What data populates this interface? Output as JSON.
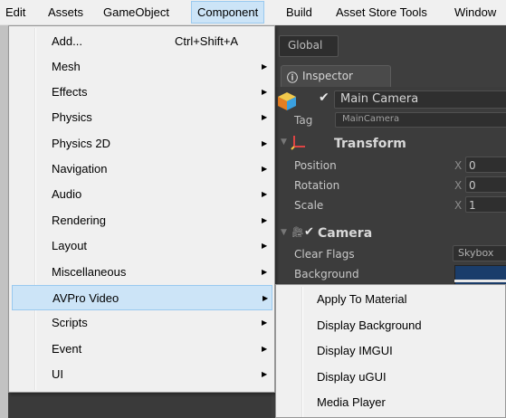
{
  "menubar": {
    "items": [
      {
        "label": "Edit"
      },
      {
        "label": "Assets"
      },
      {
        "label": "GameObject"
      },
      {
        "label": "Component"
      },
      {
        "label": "Build"
      },
      {
        "label": "Asset Store Tools"
      },
      {
        "label": "Window"
      }
    ],
    "active_index": 3
  },
  "component_menu": {
    "items": [
      {
        "label": "Add...",
        "shortcut": "Ctrl+Shift+A",
        "arrow": ""
      },
      {
        "label": "Mesh",
        "shortcut": "",
        "arrow": "▶"
      },
      {
        "label": "Effects",
        "shortcut": "",
        "arrow": "▶"
      },
      {
        "label": "Physics",
        "shortcut": "",
        "arrow": "▶"
      },
      {
        "label": "Physics 2D",
        "shortcut": "",
        "arrow": "▶"
      },
      {
        "label": "Navigation",
        "shortcut": "",
        "arrow": "▶"
      },
      {
        "label": "Audio",
        "shortcut": "",
        "arrow": "▶"
      },
      {
        "label": "Rendering",
        "shortcut": "",
        "arrow": "▶"
      },
      {
        "label": "Layout",
        "shortcut": "",
        "arrow": "▶"
      },
      {
        "label": "Miscellaneous",
        "shortcut": "",
        "arrow": "▶"
      },
      {
        "label": "AVPro Video",
        "shortcut": "",
        "arrow": "▶"
      },
      {
        "label": "Scripts",
        "shortcut": "",
        "arrow": "▶"
      },
      {
        "label": "Event",
        "shortcut": "",
        "arrow": "▶"
      },
      {
        "label": "UI",
        "shortcut": "",
        "arrow": "▶"
      }
    ],
    "highlighted_index": 10
  },
  "avpro_submenu": {
    "items": [
      {
        "label": "Apply To Material"
      },
      {
        "label": "Display Background"
      },
      {
        "label": "Display IMGUI"
      },
      {
        "label": "Display uGUI"
      },
      {
        "label": "Media Player"
      }
    ]
  },
  "editor": {
    "global_label": "Global",
    "inspector_tab": "Inspector",
    "object_name": "Main Camera",
    "tag_label": "Tag",
    "tag_value": "MainCamera",
    "transform": {
      "title": "Transform",
      "rows": [
        {
          "label": "Position",
          "axis": "X",
          "value": "0"
        },
        {
          "label": "Rotation",
          "axis": "X",
          "value": "0"
        },
        {
          "label": "Scale",
          "axis": "X",
          "value": "1"
        }
      ]
    },
    "camera": {
      "title": "Camera",
      "clear_flags_label": "Clear Flags",
      "clear_flags_value": "Skybox",
      "background_label": "Background"
    }
  },
  "colors": {
    "menu_bg": "#f0f0f0",
    "highlight_bg": "#cce4f7",
    "highlight_border": "#99c9ef",
    "editor_bg": "#3e3e3e",
    "background_swatch": "#1a3d6b"
  }
}
